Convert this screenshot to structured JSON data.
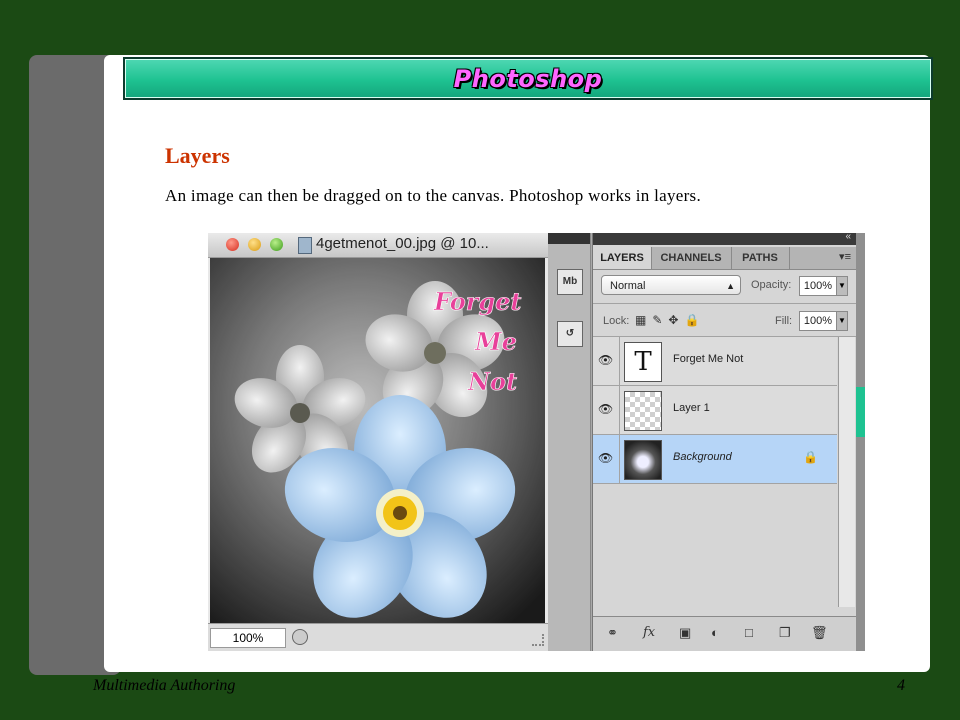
{
  "slide": {
    "title": "Photoshop",
    "heading": "Layers",
    "body": "An image can then be dragged on to the canvas. Photoshop works in layers.",
    "footer_left": "Multimedia Authoring",
    "page_number": "4"
  },
  "screenshot": {
    "doc_window": {
      "title": "4getmenot_00.jpg @ 10...",
      "zoom": "100%",
      "canvas_text": [
        "Forget",
        "Me",
        "Not"
      ]
    },
    "tool_strip": {
      "mb_label": "Mb"
    },
    "layers_panel": {
      "tabs": [
        "LAYERS",
        "CHANNELS",
        "PATHS"
      ],
      "active_tab": "LAYERS",
      "blend_mode": "Normal",
      "opacity_label": "Opacity:",
      "opacity_value": "100%",
      "lock_label": "Lock:",
      "fill_label": "Fill:",
      "fill_value": "100%",
      "layers": [
        {
          "name": "Forget Me Not",
          "type": "text",
          "thumb": "T",
          "visible": true,
          "selected": false
        },
        {
          "name": "Layer 1",
          "type": "image",
          "visible": true,
          "selected": false
        },
        {
          "name": "Background",
          "type": "background",
          "visible": true,
          "selected": true,
          "locked": true
        }
      ],
      "bottom_icons": [
        "link-icon",
        "fx-icon",
        "mask-icon",
        "adjustment-icon",
        "folder-icon",
        "new-layer-icon",
        "trash-icon"
      ]
    }
  },
  "colors": {
    "page_background": "#1b4a14",
    "title_bar": "#1ec291",
    "title_text": "#ff66ff",
    "heading": "#cc3300",
    "selected_layer": "#b6d5f7"
  }
}
